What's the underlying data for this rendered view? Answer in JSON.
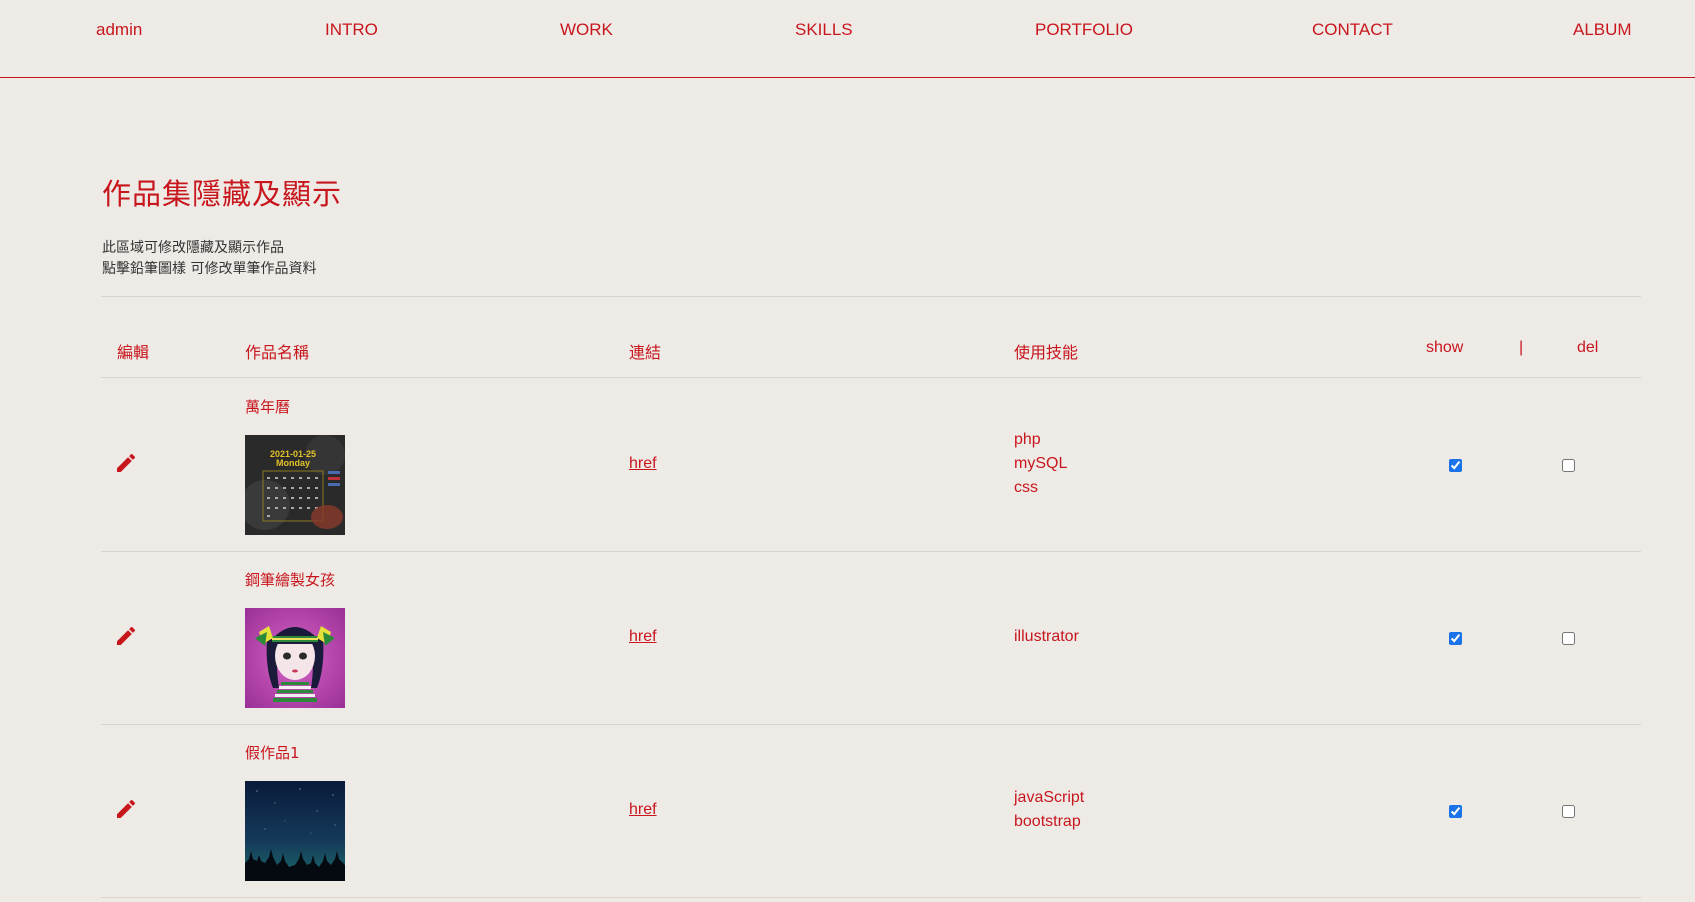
{
  "nav": {
    "items": [
      "admin",
      "INTRO",
      "WORK",
      "SKILLS",
      "PORTFOLIO",
      "CONTACT",
      "ALBUM"
    ]
  },
  "page": {
    "title": "作品集隱藏及顯示",
    "desc_line1": "此區域可修改隱藏及顯示作品",
    "desc_line2": "點擊鉛筆圖樣  可修改單筆作品資料"
  },
  "table": {
    "headers": {
      "edit": "編輯",
      "name": "作品名稱",
      "link": "連結",
      "skills": "使用技能",
      "show": "show",
      "sep": "|",
      "del": "del"
    },
    "rows": [
      {
        "name": "萬年曆",
        "link_label": "href",
        "skills": [
          "php",
          "mySQL",
          "css"
        ],
        "thumb": "calendar-thumbnail",
        "show": true,
        "del": false
      },
      {
        "name": "鋼筆繪製女孩",
        "link_label": "href",
        "skills": [
          "illustrator"
        ],
        "thumb": "girl-illustration-thumbnail",
        "show": true,
        "del": false
      },
      {
        "name": "假作品1",
        "link_label": "href",
        "skills": [
          "javaScript",
          "bootstrap"
        ],
        "thumb": "night-sky-thumbnail",
        "show": true,
        "del": false
      }
    ]
  },
  "colors": {
    "accent": "#c8161d",
    "background": "#eeebe7",
    "divider": "#d8d4cf"
  }
}
